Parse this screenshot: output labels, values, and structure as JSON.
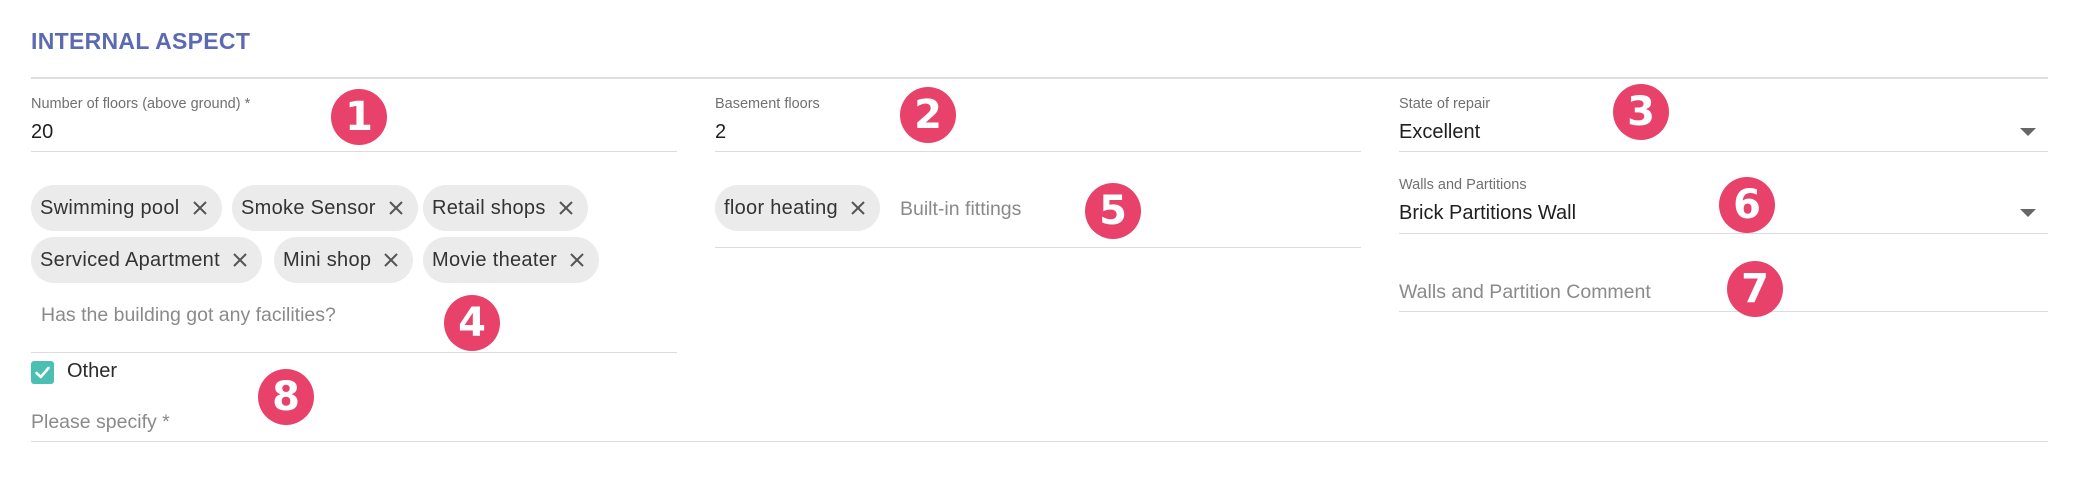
{
  "section": {
    "title": "INTERNAL ASPECT"
  },
  "fields": {
    "floors": {
      "label": "Number of floors (above ground) *",
      "value": "20"
    },
    "basement": {
      "label": "Basement floors",
      "value": "2"
    },
    "repair": {
      "label": "State of repair",
      "value": "Excellent"
    },
    "walls": {
      "label": "Walls and Partitions",
      "value": "Brick Partitions Wall"
    },
    "walls_comment": {
      "placeholder": "Walls and Partition Comment"
    },
    "please_specify": {
      "placeholder": "Please specify *"
    }
  },
  "facilities": {
    "chips": [
      "Swimming pool",
      "Smoke Sensor",
      "Retail shops",
      "Serviced Apartment",
      "Mini shop",
      "Movie theater"
    ],
    "placeholder": "Has the building got any facilities?"
  },
  "fittings": {
    "chips": [
      "floor heating"
    ],
    "placeholder": "Built-in fittings"
  },
  "other": {
    "label": "Other",
    "checked": true
  },
  "badges": [
    "1",
    "2",
    "3",
    "4",
    "5",
    "6",
    "7",
    "8"
  ],
  "colors": {
    "title": "#5c6bb0",
    "badge": "#e8426b",
    "checkbox": "#4bbfb2",
    "chip_bg": "#ebebeb"
  }
}
